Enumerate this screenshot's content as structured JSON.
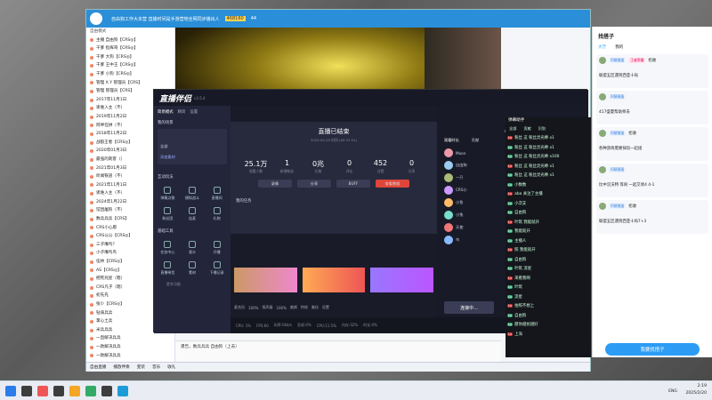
{
  "yy": {
    "title": "自由狗工作大本营 直播时间是手游营地全网同步播出人",
    "badge_id": "468160",
    "online": "44",
    "mode_label": "自由模式",
    "left_list": [
      "主播 自由狗【CRS◎】",
      "干爹 指挥哥【CRS◎】",
      "干爹 大狗【CRS◎】",
      "干爹 王中王【CRS◎】",
      "干爹 小狗【CRS◎】",
      "管理 X.Y 管理员【CRS】",
      "管理 管理员【CRS】",
      "2017年11月1日",
      "诶谁入主（不）",
      "2019年11月2日",
      "阿神在拼（不）",
      "2018年11月2日",
      "战狼王者【CRS◎】",
      "2020年01月3日",
      "最强的刺客（）",
      "2021年01月3日",
      "听闻铁道（不）",
      "2021年11月1日",
      "诶谁入主（不）",
      "2024年1月22日",
      "馆团屠狗（不）",
      "数兵兵兵【CRS】",
      "CRS小心愿",
      "CRS公公【CRS◎】",
      "三子嘴呜？",
      "小子嘴呜鸟",
      "伍林【CRS◎】",
      "AS【CRS◎】",
      "把死兆星（嗯）",
      "CRS凡子（嗯）",
      "初先先",
      "张少【CRS◎】",
      "钻骑兵兵",
      "掌心土兵",
      "米兵兵兵",
      "一直解决兵兵",
      "一款解决兵兵",
      "一款解决兵兵"
    ],
    "chat_input": "遣告，数兵兵兵 自由狗（上去）",
    "bottom_items": [
      "自由直播",
      "播放伴奏",
      "变装",
      "音乐",
      "收礼"
    ]
  },
  "companion": {
    "logo": "直播伴侣",
    "version": "v3.5.4",
    "side_tabs": [
      "简易模式",
      "精简",
      "设置"
    ],
    "scene_label": "我的场景",
    "scene_items": [
      "全部",
      "添加素材"
    ],
    "tools_title": "互动玩法",
    "tools": [
      "弹幕点歌",
      "模拟战斗",
      "直播间",
      "粉丝团",
      "连麦",
      "礼物"
    ],
    "basic_title": "基础工具",
    "basic": [
      "任务中心",
      "观众",
      "开播",
      "直播带货",
      "素材",
      "下播记录"
    ],
    "more": "更多功能",
    "ended_title": "直播已结束",
    "ended_time": "2025-02-25 时间 (00:37:51)",
    "stats": [
      {
        "value": "25.1万",
        "label": "观看人数"
      },
      {
        "value": "1",
        "label": "新增粉丝"
      },
      {
        "value": "0兆",
        "label": "礼物"
      },
      {
        "value": "0",
        "label": "评论"
      },
      {
        "value": "452",
        "label": "点赞"
      },
      {
        "value": "0",
        "label": "分享"
      }
    ],
    "buttons": [
      "录像",
      "分享",
      "BUFF",
      "查看数据"
    ],
    "tasks_title": "我的任务",
    "room_title": "本场榜单",
    "rank_tabs": [
      "观看时长",
      "贡献"
    ],
    "rank_list": [
      "Moon",
      "自由狗",
      "一只",
      "CRS小",
      "小鱼",
      "小兔",
      "天使",
      "鸟"
    ],
    "bottom_labels": [
      "麦克风",
      "100%",
      "扬声器",
      "100%",
      "美颜",
      "特效",
      "美化",
      "设置"
    ],
    "start_btn": "连接中...",
    "status": [
      "CPU: 1%",
      "FPS:60",
      "码率:0kb/s",
      "丢帧:0%",
      "CPU:11.5%",
      "内存:32%",
      "时长:0%"
    ]
  },
  "chat": {
    "title": "弹幕助手",
    "tabs": [
      "全部",
      "贡献",
      "识别"
    ],
    "rows": [
      "粉丝 这 粉丝灵光棒 x1",
      "粉丝 这 粉丝灵光棒 x1",
      "粉丝 这 粉丝灵光棒 x100",
      "粉丝 这 粉丝灵光棒 x1",
      "粉丝 这 粉丝灵光棒 x1",
      "小数数",
      "aba 关注了主播",
      "小次支",
      "自由狗",
      "叶筑 我能就开",
      "我能就开",
      "主播人",
      "照 我能就开",
      "自由狗",
      "叶筑 流星",
      "来看我啊",
      "叶筑",
      "流星",
      "拍照不想上",
      "自由狗",
      "愿你越抗越好",
      "上海"
    ]
  },
  "team": {
    "title": "找搭子",
    "tabs": [
      "大厅",
      "我的"
    ],
    "cards": [
      {
        "name": "阿猿猿蛋",
        "tag": "王者荣耀",
        "text": "联盟五区遇到西亚十局",
        "status": "招收"
      },
      {
        "name": "阿猿猿蛋",
        "tag": "",
        "text": "417盛夏帮助师去",
        "status": ""
      },
      {
        "name": "阿猿猿蛋",
        "tag": "",
        "text": "各种游戏需要快玩一起组",
        "status": "招收"
      },
      {
        "name": "阿猿猿蛋",
        "tag": "",
        "text": "比中浣沃特 等闲 一起交易4 4-1",
        "status": ""
      },
      {
        "name": "阿猿猿蛋",
        "tag": "",
        "text": "联盟五区遇到西亚十局7+3",
        "status": "招收"
      }
    ],
    "button": "我要找搭子"
  },
  "taskbar": {
    "time": "2:19",
    "date": "2025/2/20",
    "lang": "ENG"
  }
}
